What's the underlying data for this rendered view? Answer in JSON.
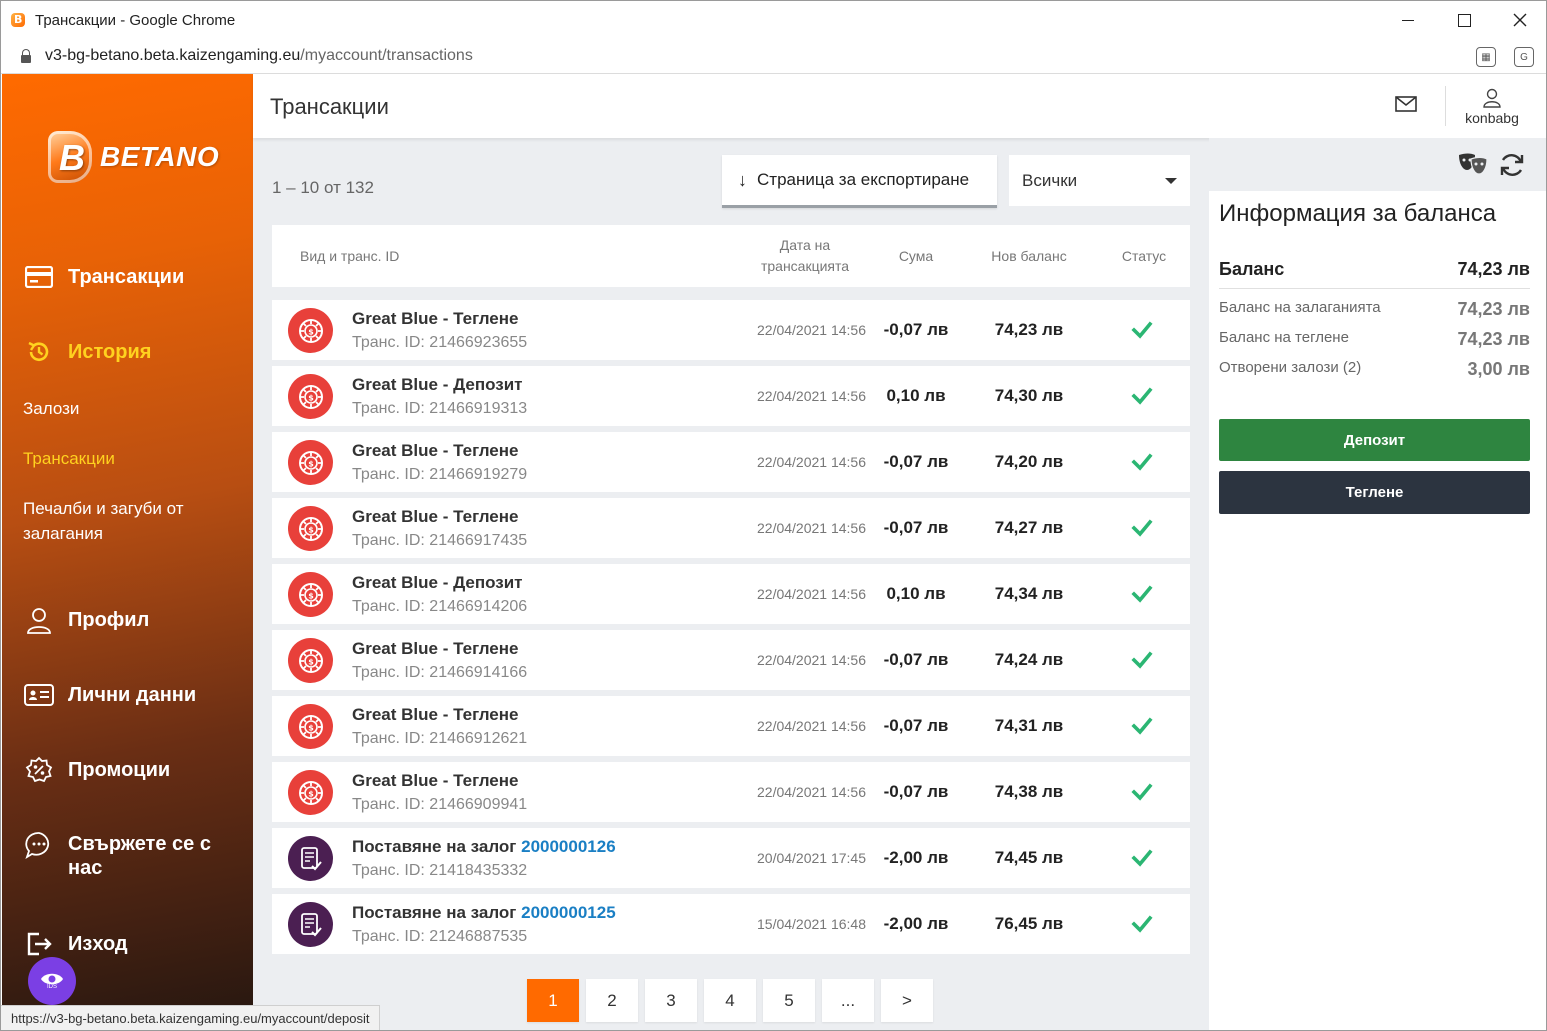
{
  "browser": {
    "window_title": "Трансакции - Google Chrome",
    "url_host": "v3-bg-betano.beta.kaizengaming.eu",
    "url_path": "/myaccount/transactions",
    "status_url": "https://v3-bg-betano.beta.kaizengaming.eu/myaccount/deposit"
  },
  "sidebar": {
    "logo_text": "BETANO",
    "nav": {
      "transactions": "Трансакции",
      "history": "История",
      "profile": "Профил",
      "personal": "Лични данни",
      "promotions": "Промоции",
      "contact": "Свържете се с нас",
      "logout": "Изход"
    },
    "subnav": {
      "bets": "Залози",
      "transactions": "Трансакции",
      "winloss": "Печалби и загуби от залагания"
    },
    "ids_label": "IDS"
  },
  "header": {
    "title": "Трансакции",
    "username": "konbabg"
  },
  "toolbar": {
    "count": "1 – 10 от 132",
    "export_label": "Страница за експортиране",
    "filter_value": "Всички"
  },
  "table": {
    "headers": {
      "type": "Вид и транс. ID",
      "date": "Дата на трансакцията",
      "amount": "Сума",
      "new_balance": "Нов баланс",
      "status": "Статус"
    },
    "rows": [
      {
        "kind": "casino",
        "name": "Great Blue - Теглене",
        "link": "",
        "tid": "Транс. ID: 21466923655",
        "date": "22/04/2021 14:56",
        "amount": "-0,07 лв",
        "new_balance": "74,23 лв"
      },
      {
        "kind": "casino",
        "name": "Great Blue - Депозит",
        "link": "",
        "tid": "Транс. ID: 21466919313",
        "date": "22/04/2021 14:56",
        "amount": "0,10 лв",
        "new_balance": "74,30 лв"
      },
      {
        "kind": "casino",
        "name": "Great Blue - Теглене",
        "link": "",
        "tid": "Транс. ID: 21466919279",
        "date": "22/04/2021 14:56",
        "amount": "-0,07 лв",
        "new_balance": "74,20 лв"
      },
      {
        "kind": "casino",
        "name": "Great Blue - Теглене",
        "link": "",
        "tid": "Транс. ID: 21466917435",
        "date": "22/04/2021 14:56",
        "amount": "-0,07 лв",
        "new_balance": "74,27 лв"
      },
      {
        "kind": "casino",
        "name": "Great Blue - Депозит",
        "link": "",
        "tid": "Транс. ID: 21466914206",
        "date": "22/04/2021 14:56",
        "amount": "0,10 лв",
        "new_balance": "74,34 лв"
      },
      {
        "kind": "casino",
        "name": "Great Blue - Теглене",
        "link": "",
        "tid": "Транс. ID: 21466914166",
        "date": "22/04/2021 14:56",
        "amount": "-0,07 лв",
        "new_balance": "74,24 лв"
      },
      {
        "kind": "casino",
        "name": "Great Blue - Теглене",
        "link": "",
        "tid": "Транс. ID: 21466912621",
        "date": "22/04/2021 14:56",
        "amount": "-0,07 лв",
        "new_balance": "74,31 лв"
      },
      {
        "kind": "casino",
        "name": "Great Blue - Теглене",
        "link": "",
        "tid": "Транс. ID: 21466909941",
        "date": "22/04/2021 14:56",
        "amount": "-0,07 лв",
        "new_balance": "74,38 лв"
      },
      {
        "kind": "bet",
        "name": "Поставяне на залог ",
        "link": "2000000126",
        "tid": "Транс. ID: 21418435332",
        "date": "20/04/2021 17:45",
        "amount": "-2,00 лв",
        "new_balance": "74,45 лв"
      },
      {
        "kind": "bet",
        "name": "Поставяне на залог ",
        "link": "2000000125",
        "tid": "Транс. ID: 21246887535",
        "date": "15/04/2021 16:48",
        "amount": "-2,00 лв",
        "new_balance": "76,45 лв"
      }
    ]
  },
  "pagination": [
    "1",
    "2",
    "3",
    "4",
    "5",
    "...",
    ">"
  ],
  "balance": {
    "title": "Информация за баланса",
    "main_label": "Баланс",
    "main_value": "74,23 лв",
    "rows": [
      {
        "label": "Баланс на залаганията",
        "value": "74,23 лв"
      },
      {
        "label": "Баланс на теглене",
        "value": "74,23 лв"
      },
      {
        "label": "Отворени залози (2)",
        "value": "3,00 лв"
      }
    ],
    "deposit_label": "Депозит",
    "withdraw_label": "Теглене"
  },
  "colors": {
    "brand_orange": "#ff6a00",
    "active_yellow": "#ffd21f",
    "success_green": "#2e8540",
    "check_green": "#2bb673",
    "link_blue": "#1a7fc4"
  }
}
